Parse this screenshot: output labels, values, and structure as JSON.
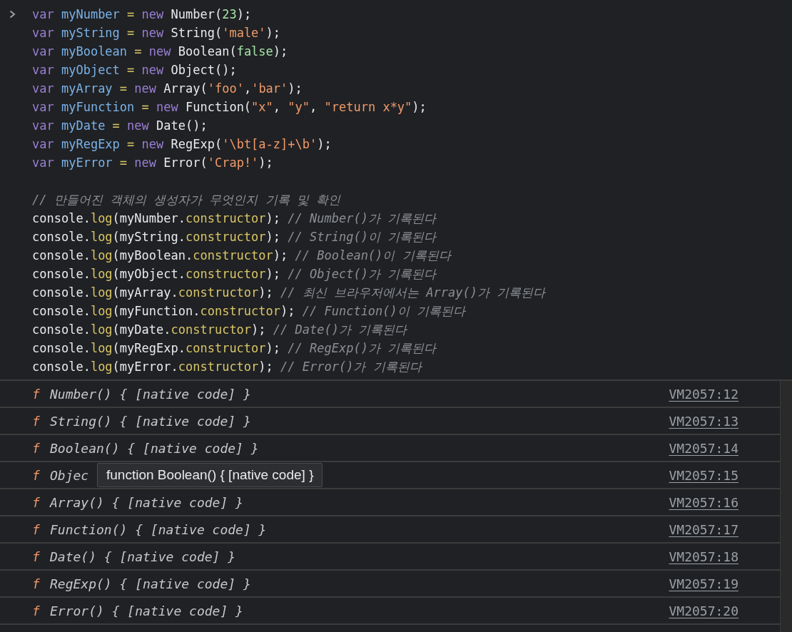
{
  "input": {
    "declarations": [
      {
        "tokens": [
          {
            "kind": "keyword",
            "text": "var "
          },
          {
            "kind": "def",
            "text": "myNumber "
          },
          {
            "kind": "op",
            "text": "= "
          },
          {
            "kind": "keyword",
            "text": "new "
          },
          {
            "kind": "plain",
            "text": "Number("
          },
          {
            "kind": "literal",
            "text": "23"
          },
          {
            "kind": "plain",
            "text": ");"
          }
        ]
      },
      {
        "tokens": [
          {
            "kind": "keyword",
            "text": "var "
          },
          {
            "kind": "def",
            "text": "myString "
          },
          {
            "kind": "op",
            "text": "= "
          },
          {
            "kind": "keyword",
            "text": "new "
          },
          {
            "kind": "plain",
            "text": "String("
          },
          {
            "kind": "string",
            "text": "'male'"
          },
          {
            "kind": "plain",
            "text": ");"
          }
        ]
      },
      {
        "tokens": [
          {
            "kind": "keyword",
            "text": "var "
          },
          {
            "kind": "def",
            "text": "myBoolean "
          },
          {
            "kind": "op",
            "text": "= "
          },
          {
            "kind": "keyword",
            "text": "new "
          },
          {
            "kind": "plain",
            "text": "Boolean("
          },
          {
            "kind": "literal",
            "text": "false"
          },
          {
            "kind": "plain",
            "text": ");"
          }
        ]
      },
      {
        "tokens": [
          {
            "kind": "keyword",
            "text": "var "
          },
          {
            "kind": "def",
            "text": "myObject "
          },
          {
            "kind": "op",
            "text": "= "
          },
          {
            "kind": "keyword",
            "text": "new "
          },
          {
            "kind": "plain",
            "text": "Object();"
          }
        ]
      },
      {
        "tokens": [
          {
            "kind": "keyword",
            "text": "var "
          },
          {
            "kind": "def",
            "text": "myArray "
          },
          {
            "kind": "op",
            "text": "= "
          },
          {
            "kind": "keyword",
            "text": "new "
          },
          {
            "kind": "plain",
            "text": "Array("
          },
          {
            "kind": "string",
            "text": "'foo'"
          },
          {
            "kind": "plain",
            "text": ","
          },
          {
            "kind": "string",
            "text": "'bar'"
          },
          {
            "kind": "plain",
            "text": ");"
          }
        ]
      },
      {
        "tokens": [
          {
            "kind": "keyword",
            "text": "var "
          },
          {
            "kind": "def",
            "text": "myFunction "
          },
          {
            "kind": "op",
            "text": "= "
          },
          {
            "kind": "keyword",
            "text": "new "
          },
          {
            "kind": "plain",
            "text": "Function("
          },
          {
            "kind": "string",
            "text": "\"x\""
          },
          {
            "kind": "plain",
            "text": ", "
          },
          {
            "kind": "string",
            "text": "\"y\""
          },
          {
            "kind": "plain",
            "text": ", "
          },
          {
            "kind": "string",
            "text": "\"return x*y\""
          },
          {
            "kind": "plain",
            "text": ");"
          }
        ]
      },
      {
        "tokens": [
          {
            "kind": "keyword",
            "text": "var "
          },
          {
            "kind": "def",
            "text": "myDate "
          },
          {
            "kind": "op",
            "text": "= "
          },
          {
            "kind": "keyword",
            "text": "new "
          },
          {
            "kind": "plain",
            "text": "Date();"
          }
        ]
      },
      {
        "tokens": [
          {
            "kind": "keyword",
            "text": "var "
          },
          {
            "kind": "def",
            "text": "myRegExp "
          },
          {
            "kind": "op",
            "text": "= "
          },
          {
            "kind": "keyword",
            "text": "new "
          },
          {
            "kind": "plain",
            "text": "RegExp("
          },
          {
            "kind": "string",
            "text": "'\\bt[a-z]+\\b'"
          },
          {
            "kind": "plain",
            "text": ");"
          }
        ]
      },
      {
        "tokens": [
          {
            "kind": "keyword",
            "text": "var "
          },
          {
            "kind": "def",
            "text": "myError "
          },
          {
            "kind": "op",
            "text": "= "
          },
          {
            "kind": "keyword",
            "text": "new "
          },
          {
            "kind": "plain",
            "text": "Error("
          },
          {
            "kind": "string",
            "text": "'Crap!'"
          },
          {
            "kind": "plain",
            "text": ");"
          }
        ]
      }
    ],
    "logs": [
      {
        "tokens": [
          {
            "kind": "comment",
            "text": "// 만들어진 객체의 생성자가 무엇인지 기록 및 확인"
          }
        ]
      },
      {
        "tokens": [
          {
            "kind": "plain",
            "text": "console."
          },
          {
            "kind": "method",
            "text": "log"
          },
          {
            "kind": "plain",
            "text": "(myNumber."
          },
          {
            "kind": "method",
            "text": "constructor"
          },
          {
            "kind": "plain",
            "text": "); "
          },
          {
            "kind": "comment",
            "text": "// Number()가 기록된다"
          }
        ]
      },
      {
        "tokens": [
          {
            "kind": "plain",
            "text": "console."
          },
          {
            "kind": "method",
            "text": "log"
          },
          {
            "kind": "plain",
            "text": "(myString."
          },
          {
            "kind": "method",
            "text": "constructor"
          },
          {
            "kind": "plain",
            "text": "); "
          },
          {
            "kind": "comment",
            "text": "// String()이 기록된다"
          }
        ]
      },
      {
        "tokens": [
          {
            "kind": "plain",
            "text": "console."
          },
          {
            "kind": "method",
            "text": "log"
          },
          {
            "kind": "plain",
            "text": "(myBoolean."
          },
          {
            "kind": "method",
            "text": "constructor"
          },
          {
            "kind": "plain",
            "text": "); "
          },
          {
            "kind": "comment",
            "text": "// Boolean()이 기록된다"
          }
        ]
      },
      {
        "tokens": [
          {
            "kind": "plain",
            "text": "console."
          },
          {
            "kind": "method",
            "text": "log"
          },
          {
            "kind": "plain",
            "text": "(myObject."
          },
          {
            "kind": "method",
            "text": "constructor"
          },
          {
            "kind": "plain",
            "text": "); "
          },
          {
            "kind": "comment",
            "text": "// Object()가 기록된다"
          }
        ]
      },
      {
        "tokens": [
          {
            "kind": "plain",
            "text": "console."
          },
          {
            "kind": "method",
            "text": "log"
          },
          {
            "kind": "plain",
            "text": "(myArray."
          },
          {
            "kind": "method",
            "text": "constructor"
          },
          {
            "kind": "plain",
            "text": "); "
          },
          {
            "kind": "comment",
            "text": "// 최신 브라우저에서는 Array()가 기록된다"
          }
        ]
      },
      {
        "tokens": [
          {
            "kind": "plain",
            "text": "console."
          },
          {
            "kind": "method",
            "text": "log"
          },
          {
            "kind": "plain",
            "text": "(myFunction."
          },
          {
            "kind": "method",
            "text": "constructor"
          },
          {
            "kind": "plain",
            "text": "); "
          },
          {
            "kind": "comment",
            "text": "// Function()이 기록된다"
          }
        ]
      },
      {
        "tokens": [
          {
            "kind": "plain",
            "text": "console."
          },
          {
            "kind": "method",
            "text": "log"
          },
          {
            "kind": "plain",
            "text": "(myDate."
          },
          {
            "kind": "method",
            "text": "constructor"
          },
          {
            "kind": "plain",
            "text": "); "
          },
          {
            "kind": "comment",
            "text": "// Date()가 기록된다"
          }
        ]
      },
      {
        "tokens": [
          {
            "kind": "plain",
            "text": "console."
          },
          {
            "kind": "method",
            "text": "log"
          },
          {
            "kind": "plain",
            "text": "(myRegExp."
          },
          {
            "kind": "method",
            "text": "constructor"
          },
          {
            "kind": "plain",
            "text": "); "
          },
          {
            "kind": "comment",
            "text": "// RegExp()가 기록된다"
          }
        ]
      },
      {
        "tokens": [
          {
            "kind": "plain",
            "text": "console."
          },
          {
            "kind": "method",
            "text": "log"
          },
          {
            "kind": "plain",
            "text": "(myError."
          },
          {
            "kind": "method",
            "text": "constructor"
          },
          {
            "kind": "plain",
            "text": "); "
          },
          {
            "kind": "comment",
            "text": "// Error()가 기록된다"
          }
        ]
      }
    ]
  },
  "output": [
    {
      "marker": "f",
      "text": "Number() { [native code] }",
      "source": "VM2057:12"
    },
    {
      "marker": "f",
      "text": "String() { [native code] }",
      "source": "VM2057:13"
    },
    {
      "marker": "f",
      "text": "Boolean() { [native code] }",
      "source": "VM2057:14"
    },
    {
      "marker": "f",
      "text": "Objec",
      "source": "VM2057:15",
      "tooltip": "function Boolean() { [native code] }"
    },
    {
      "marker": "f",
      "text": "Array() { [native code] }",
      "source": "VM2057:16"
    },
    {
      "marker": "f",
      "text": "Function() { [native code] }",
      "source": "VM2057:17"
    },
    {
      "marker": "f",
      "text": "Date() { [native code] }",
      "source": "VM2057:18"
    },
    {
      "marker": "f",
      "text": "RegExp() { [native code] }",
      "source": "VM2057:19"
    },
    {
      "marker": "f",
      "text": "Error() { [native code] }",
      "source": "VM2057:20"
    }
  ]
}
